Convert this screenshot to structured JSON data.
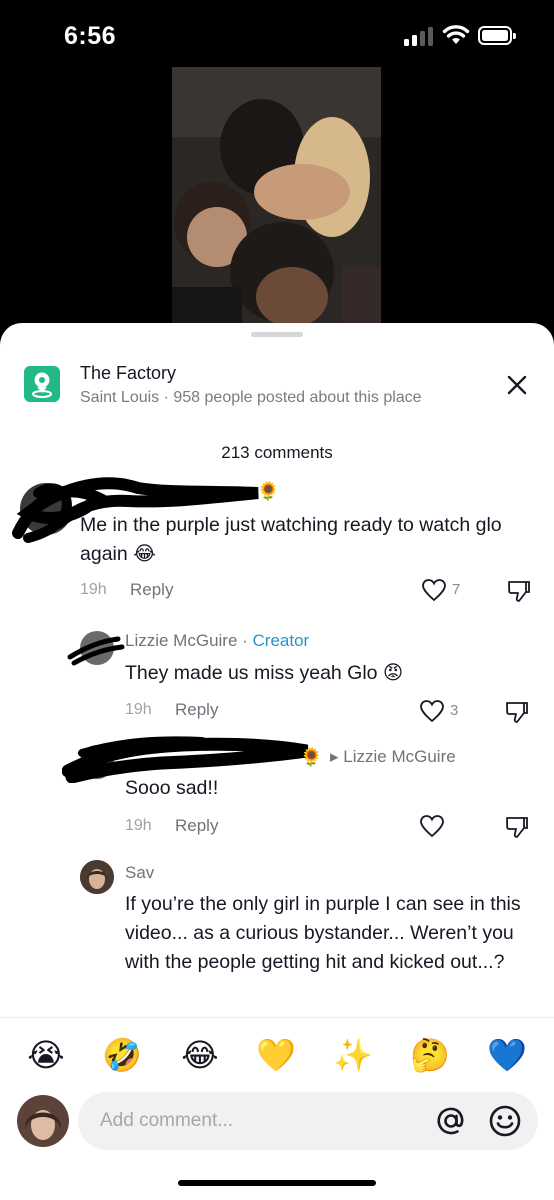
{
  "status_bar": {
    "time": "6:56",
    "signal_bars_active": 2,
    "battery_level": 1.0
  },
  "video": {
    "description_icon": "video-thumbnail"
  },
  "place": {
    "icon": "location-pin-icon",
    "icon_color": "#20b987",
    "name": "The Factory",
    "subtitle": "Saint Louis · 958 people posted about this place"
  },
  "comments_header": {
    "count_label": "213 comments"
  },
  "comments": [
    {
      "name": "",
      "redacted": true,
      "text": "Me in the purple just watching ready to watch glo again 😂",
      "time": "19h",
      "reply_label": "Reply",
      "likes": "7"
    },
    {
      "name": "Lizzie McGuire",
      "badge": "Creator",
      "separator": " · ",
      "text": "They made us miss yeah Glo 😡",
      "time": "19h",
      "reply_label": "Reply",
      "likes": "3"
    },
    {
      "name": "",
      "redacted": true,
      "reply_to": "Lizzie McGuire",
      "text": "Sooo sad!!",
      "time": "19h",
      "reply_label": "Reply",
      "likes": ""
    },
    {
      "name": "Sav",
      "text": "If you’re the only girl in purple I can see in this video... as a curious bystander... Weren’t you with the people getting hit and kicked out...?"
    }
  ],
  "quick_emojis": [
    "😭",
    "🤣",
    "😂",
    "💛",
    "✨",
    "🤔",
    "💙"
  ],
  "input": {
    "placeholder": "Add comment...",
    "at_icon": "at-icon",
    "emoji_icon": "smile-icon"
  },
  "colors": {
    "creator_accent": "#2b94c7",
    "text_primary": "#161823",
    "text_secondary": "#72737a"
  }
}
